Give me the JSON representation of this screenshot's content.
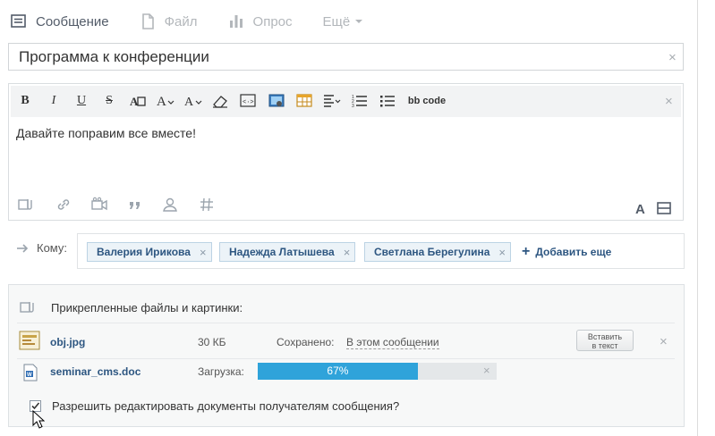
{
  "tabs": [
    {
      "label": "Сообщение",
      "icon": "message-icon"
    },
    {
      "label": "Файл",
      "icon": "file-icon"
    },
    {
      "label": "Опрос",
      "icon": "poll-icon"
    },
    {
      "label": "Ещё",
      "icon": "chevron-down-icon"
    }
  ],
  "title": {
    "value": "Программа к конференции"
  },
  "toolbar": {
    "bbcode_label": "bb code"
  },
  "editor": {
    "text": "Давайте поправим все вместе!"
  },
  "recipients": {
    "label": "Кому:",
    "chips": [
      {
        "name": "Валерия Ирикова"
      },
      {
        "name": "Надежда Латышева"
      },
      {
        "name": "Светлана Берегулина"
      }
    ],
    "add_more": "Добавить еще"
  },
  "attachments": {
    "heading": "Прикрепленные файлы и картинки:",
    "files": [
      {
        "name": "obj.jpg",
        "size": "30 КБ",
        "status_label": "Сохранено:",
        "status_value": "В этом сообщении",
        "insert_label_1": "Вставить",
        "insert_label_2": "в текст"
      },
      {
        "name": "seminar_cms.doc",
        "status_label": "Загрузка:",
        "progress_percent": 67,
        "progress_text": "67%"
      }
    ],
    "allow_edit_label": "Разрешить редактировать документы получателям сообщения?",
    "allow_edit_checked": true
  },
  "colors": {
    "link": "#2d5681",
    "progress": "#2fa3da",
    "chip_bg": "#ecf3f8"
  }
}
